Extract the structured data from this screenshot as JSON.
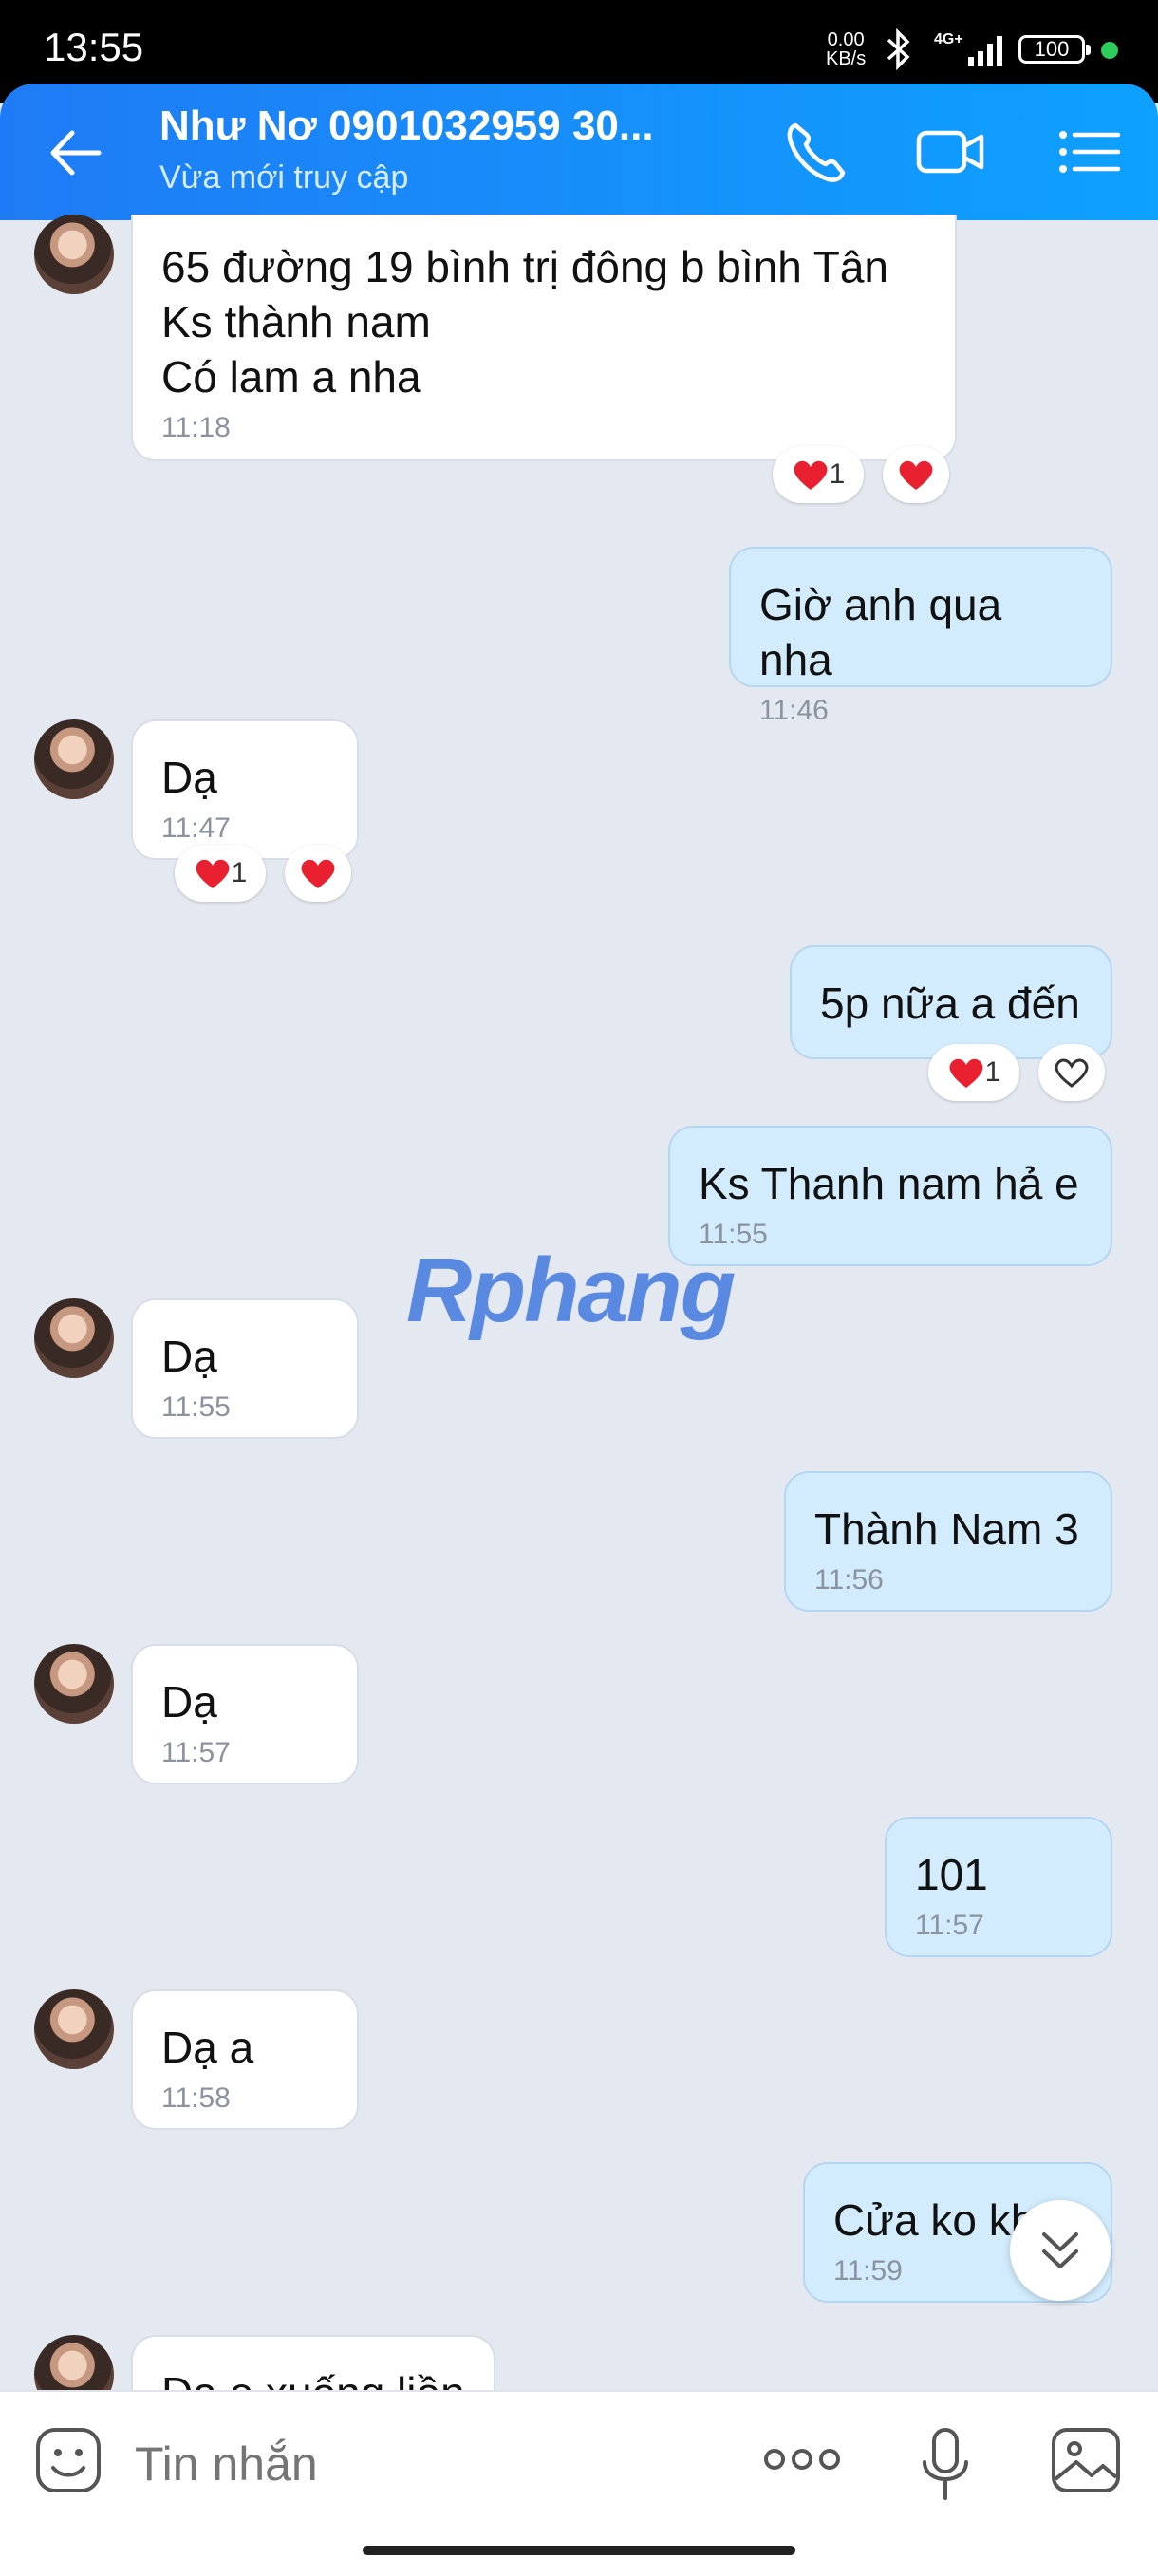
{
  "status_bar": {
    "time": "13:55",
    "net_speed": "0.00\nKB/s",
    "network": "4G+",
    "battery": "100"
  },
  "header": {
    "title": "Như Nơ 0901032959 30...",
    "subtitle": "Vừa mới truy cập",
    "icons": [
      "back-arrow-icon",
      "phone-icon",
      "video-call-icon",
      "menu-list-icon"
    ]
  },
  "messages": [
    {
      "dir": "in",
      "text": "65 đường 19 bình trị đông b bình Tân\nKs thành nam\nCó lam a nha",
      "time": "11:18",
      "reaction_count": "1"
    },
    {
      "dir": "out",
      "text": "Giờ anh qua nha",
      "time": "11:46"
    },
    {
      "dir": "in",
      "text": "Dạ",
      "time": "11:47",
      "reaction_count": "1"
    },
    {
      "dir": "out",
      "text": "5p nữa a đến",
      "time": "",
      "reaction_count": "1"
    },
    {
      "dir": "out",
      "text": "Ks Thanh nam hả e",
      "time": "11:55"
    },
    {
      "dir": "in",
      "text": "Dạ",
      "time": "11:55"
    },
    {
      "dir": "out",
      "text": "Thành Nam 3",
      "time": "11:56"
    },
    {
      "dir": "in",
      "text": "Dạ",
      "time": "11:57"
    },
    {
      "dir": "out",
      "text": "101",
      "time": "11:57"
    },
    {
      "dir": "in",
      "text": "Dạ a",
      "time": "11:58"
    },
    {
      "dir": "out",
      "text": "Cửa ko kh",
      "time": "11:59"
    },
    {
      "dir": "in",
      "text": "Dạ e xuống liền",
      "time": ""
    }
  ],
  "watermark": "Rphang",
  "composer": {
    "placeholder": "Tin nhắn"
  },
  "colors": {
    "header_start": "#1f7bf5",
    "header_end": "#0ea1ff",
    "background": "#e4e8f0",
    "outgoing_bubble": "#d2ecfd",
    "incoming_bubble": "#ffffff",
    "heart": "#e8202f"
  }
}
